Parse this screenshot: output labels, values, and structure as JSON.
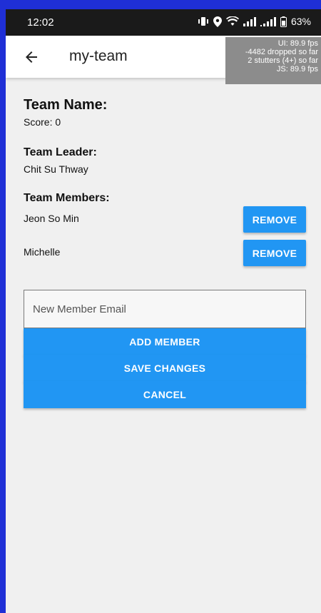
{
  "status_bar": {
    "time": "12:02",
    "battery": "63%"
  },
  "app_bar": {
    "title": "my-team"
  },
  "perf_overlay": {
    "lines": [
      "UI: 89.9 fps",
      "-4482 dropped so far",
      "2 stutters (4+) so far",
      "JS: 89.9 fps"
    ]
  },
  "team": {
    "name_label": "Team Name:",
    "score_text": "Score: 0",
    "leader_label": "Team Leader:",
    "leader_name": "Chit Su Thway",
    "members_label": "Team Members:",
    "members": [
      {
        "name": "Jeon So Min",
        "action": "REMOVE"
      },
      {
        "name": "Michelle",
        "action": "REMOVE"
      }
    ]
  },
  "form": {
    "email_placeholder": "New Member Email",
    "email_value": "",
    "add_label": "ADD MEMBER",
    "save_label": "SAVE CHANGES",
    "cancel_label": "CANCEL"
  },
  "colors": {
    "accent": "#2196f3",
    "frame": "#1f2fd6",
    "background": "#f0f0f0"
  }
}
